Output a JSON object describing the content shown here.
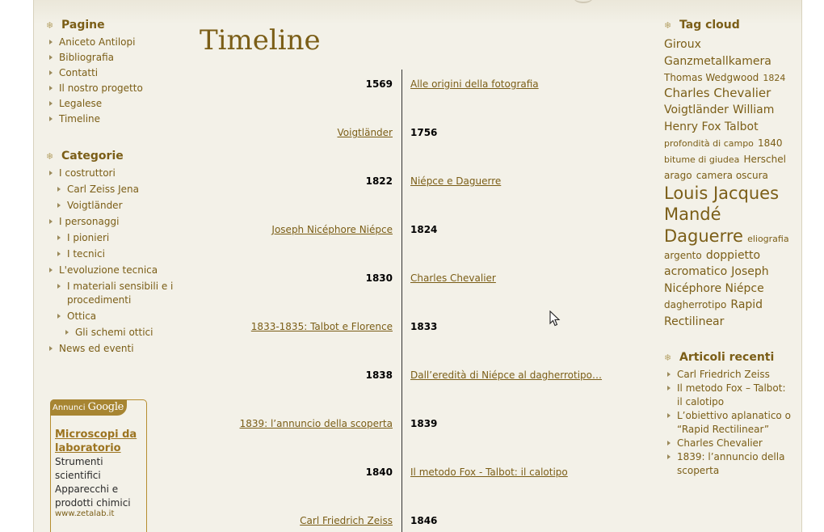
{
  "sidebar": {
    "pages_title": "Pagine",
    "pages": [
      "Aniceto Antilopi",
      "Bibliografia",
      "Contatti",
      "Il nostro progetto",
      "Legalese",
      "Timeline"
    ],
    "categories_title": "Categorie",
    "categories": [
      {
        "label": "I costruttori",
        "level": 0
      },
      {
        "label": "Carl Zeiss Jena",
        "level": 1
      },
      {
        "label": "Voigtländer",
        "level": 1
      },
      {
        "label": "I personaggi",
        "level": 0
      },
      {
        "label": "I pionieri",
        "level": 1
      },
      {
        "label": "I tecnici",
        "level": 1
      },
      {
        "label": "L'evoluzione tecnica",
        "level": 0
      },
      {
        "label": "I materiali sensibili e i procedimenti",
        "level": 1
      },
      {
        "label": "Ottica",
        "level": 1
      },
      {
        "label": "Gli schemi ottici",
        "level": 2
      },
      {
        "label": "News ed eventi",
        "level": 0
      }
    ]
  },
  "ad": {
    "header_prefix": "Annunci",
    "header_brand": "Google",
    "title": "Microscopi da laboratorio",
    "text": "Strumenti scientifici Apparecchi e prodotti chimici",
    "url": "www.zetalab.it"
  },
  "main": {
    "title": "Timeline",
    "entries": [
      {
        "year": "1569",
        "title": "Alle origini della fotografia",
        "side": "right"
      },
      {
        "year": "1756",
        "title": "Voigtländer",
        "side": "left"
      },
      {
        "year": "1822",
        "title": "Niépce e Daguerre",
        "side": "right"
      },
      {
        "year": "1824",
        "title": "Joseph Nicéphore Niépce",
        "side": "left"
      },
      {
        "year": "1830",
        "title": "Charles Chevalier",
        "side": "right"
      },
      {
        "year": "1833",
        "title": "1833-1835: Talbot e Florence",
        "side": "left"
      },
      {
        "year": "1838",
        "title": "Dall’eredità di Niépce al dagherrotipo…",
        "side": "right"
      },
      {
        "year": "1839",
        "title": "1839: l’annuncio della scoperta",
        "side": "left"
      },
      {
        "year": "1840",
        "title": "Il metodo Fox - Talbot: il calotipo",
        "side": "right"
      },
      {
        "year": "1846",
        "title": "Carl Friedrich Zeiss",
        "side": "left"
      }
    ]
  },
  "tagcloud": {
    "title": "Tag cloud",
    "tags": [
      {
        "label": "Giroux",
        "size": 14
      },
      {
        "label": "Ganzmetallkamera",
        "size": 14
      },
      {
        "label": "Thomas Wedgwood",
        "size": 12
      },
      {
        "label": "1824",
        "size": 11
      },
      {
        "label": "Charles Chevalier",
        "size": 15
      },
      {
        "label": "Voigtländer",
        "size": 14
      },
      {
        "label": "William Henry Fox Talbot",
        "size": 14
      },
      {
        "label": "profondità di campo",
        "size": 11
      },
      {
        "label": "1840",
        "size": 12
      },
      {
        "label": "bitume di giudea",
        "size": 11
      },
      {
        "label": "Herschel",
        "size": 12
      },
      {
        "label": "arago",
        "size": 12
      },
      {
        "label": "camera oscura",
        "size": 12
      },
      {
        "label": "Louis Jacques Mandé Daguerre",
        "size": 21
      },
      {
        "label": "eliografia",
        "size": 11
      },
      {
        "label": "argento",
        "size": 12
      },
      {
        "label": "doppietto acromatico",
        "size": 14
      },
      {
        "label": "Joseph Nicéphore Niépce",
        "size": 14
      },
      {
        "label": "dagherrotipo",
        "size": 12
      },
      {
        "label": "Rapid Rectilinear",
        "size": 14
      }
    ]
  },
  "recent": {
    "title": "Articoli recenti",
    "items": [
      "Carl Friedrich Zeiss",
      "Il metodo Fox – Talbot: il calotipo",
      "L’obiettivo aplanatico o “Rapid Rectilinear”",
      "Charles Chevalier",
      "1839: l’annuncio della scoperta"
    ]
  },
  "colors": {
    "accent": "#7b5e17",
    "background": "#f3f1e8",
    "ad_border": "#b68d2f"
  }
}
